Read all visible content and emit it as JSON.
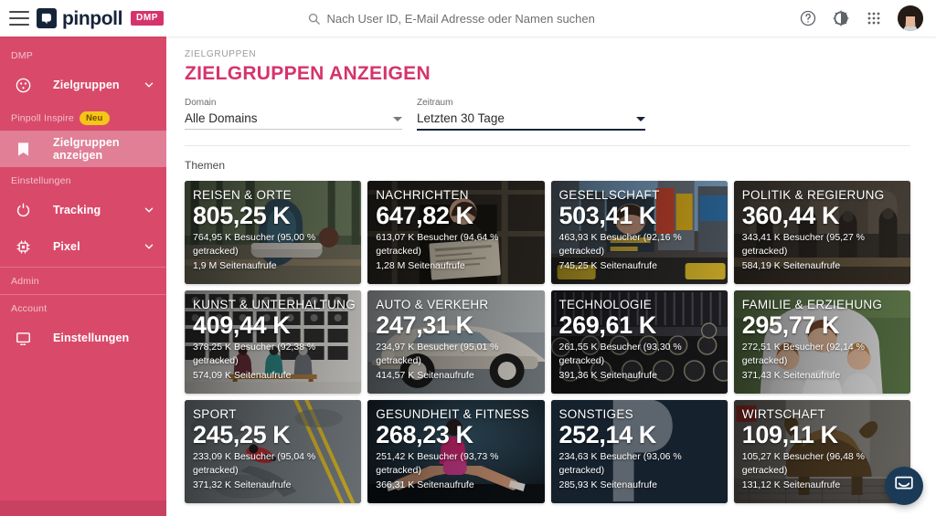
{
  "topbar": {
    "menu_icon": "hamburger-icon",
    "brand_name": "pinpoll",
    "brand_tag": "DMP",
    "search_placeholder": "Nach User ID, E-Mail Adresse oder Namen suchen",
    "search_value": "",
    "search_icon": "search-icon",
    "help_icon": "help-circle-icon",
    "theme_icon": "brightness-contrast-icon",
    "apps_icon": "apps-grid-icon",
    "avatar_icon": "user-avatar"
  },
  "sidebar": {
    "sections": [
      {
        "label": "DMP"
      },
      {
        "label": "Pinpoll Inspire",
        "badge": "Neu"
      },
      {
        "label": "Einstellungen"
      },
      {
        "label": "Admin"
      },
      {
        "label": "Account"
      }
    ],
    "items": [
      {
        "label": "Zielgruppen",
        "icon": "audience-icon",
        "expandable": true,
        "active": false
      },
      {
        "label": "Zielgruppen anzeigen",
        "icon": "book-icon",
        "expandable": false,
        "active": true
      },
      {
        "label": "Tracking",
        "icon": "tracking-icon",
        "expandable": true,
        "active": false
      },
      {
        "label": "Pixel",
        "icon": "chip-icon",
        "expandable": true,
        "active": false
      },
      {
        "label": "Einstellungen",
        "icon": "monitor-icon",
        "expandable": false,
        "active": false
      }
    ]
  },
  "main": {
    "breadcrumb": "ZIELGRUPPEN",
    "title": "ZIELGRUPPEN ANZEIGEN",
    "filters": [
      {
        "label": "Domain",
        "value": "Alle Domains"
      },
      {
        "label": "Zeitraum",
        "value": "Letzten 30 Tage"
      }
    ],
    "section_label": "Themen",
    "cards": [
      {
        "title": "REISEN & ORTE",
        "value": "805,25 K",
        "visitors": "764,95 K Besucher (95,00 % getracked)",
        "pageviews": "1,9 M Seitenaufrufe",
        "bg": "travel"
      },
      {
        "title": "NACHRICHTEN",
        "value": "647,82 K",
        "visitors": "613,07 K Besucher (94,64 % getracked)",
        "pageviews": "1,28 M Seitenaufrufe",
        "bg": "news"
      },
      {
        "title": "GESELLSCHAFT",
        "value": "503,41 K",
        "visitors": "463,93 K Besucher (92,16 % getracked)",
        "pageviews": "745,25 K Seitenaufrufe",
        "bg": "society"
      },
      {
        "title": "POLITIK & REGIERUNG",
        "value": "360,44 K",
        "visitors": "343,41 K Besucher (95,27 % getracked)",
        "pageviews": "584,19 K Seitenaufrufe",
        "bg": "politics"
      },
      {
        "title": "KUNST & UNTERHALTUNG",
        "value": "409,44 K",
        "visitors": "378,25 K Besucher (92,38 % getracked)",
        "pageviews": "574,09 K Seitenaufrufe",
        "bg": "art"
      },
      {
        "title": "AUTO & VERKEHR",
        "value": "247,31 K",
        "visitors": "234,97 K Besucher (95,01 % getracked)",
        "pageviews": "414,57 K Seitenaufrufe",
        "bg": "auto"
      },
      {
        "title": "TECHNOLOGIE",
        "value": "269,61 K",
        "visitors": "261,55 K Besucher (93,30 % getracked)",
        "pageviews": "391,36 K Seitenaufrufe",
        "bg": "tech"
      },
      {
        "title": "FAMILIE & ERZIEHUNG",
        "value": "295,77 K",
        "visitors": "272,51 K Besucher (92,14 % getracked)",
        "pageviews": "371,43 K Seitenaufrufe",
        "bg": "family"
      },
      {
        "title": "SPORT",
        "value": "245,25 K",
        "visitors": "233,09 K Besucher (95,04 % getracked)",
        "pageviews": "371,32 K Seitenaufrufe",
        "bg": "sport"
      },
      {
        "title": "GESUNDHEIT & FITNESS",
        "value": "268,23 K",
        "visitors": "251,42 K Besucher (93,73 % getracked)",
        "pageviews": "366,31 K Seitenaufrufe",
        "bg": "health"
      },
      {
        "title": "SONSTIGES",
        "value": "252,14 K",
        "visitors": "234,63 K Besucher (93,06 % getracked)",
        "pageviews": "285,93 K Seitenaufrufe",
        "bg": "other"
      },
      {
        "title": "WIRTSCHAFT",
        "value": "109,11 K",
        "visitors": "105,27 K Besucher (96,48 % getracked)",
        "pageviews": "131,12 K Seitenaufrufe",
        "bg": "economy"
      }
    ]
  },
  "widgets": {
    "intercom_icon": "chat-bubble-icon"
  },
  "colors": {
    "brand_pink": "#d6336c",
    "sidebar": "#d94a6a",
    "sidebar_active": "#e07f96",
    "navy": "#16243a",
    "badge_yellow": "#f5c518"
  }
}
